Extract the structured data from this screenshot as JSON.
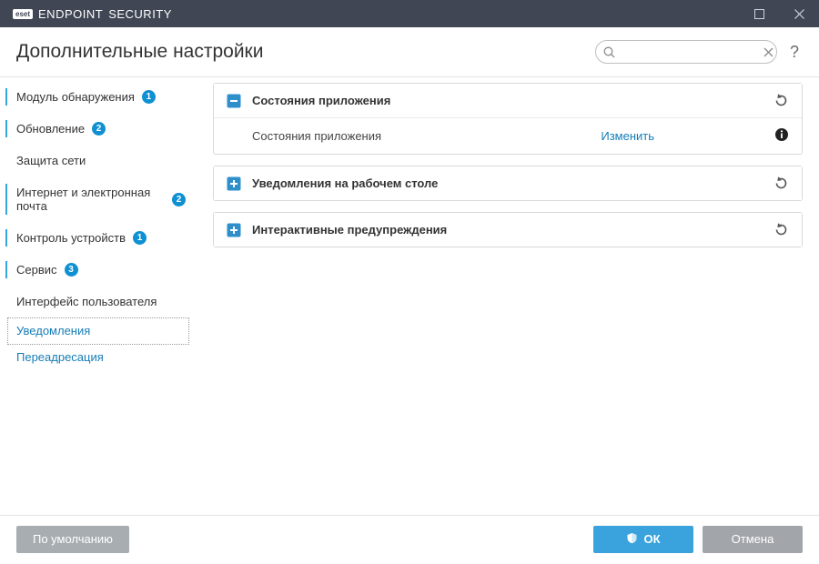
{
  "titlebar": {
    "brand_badge": "eset",
    "brand_word1": "ENDPOINT",
    "brand_word2": "SECURITY"
  },
  "header": {
    "title": "Дополнительные настройки",
    "search_placeholder": "",
    "help": "?"
  },
  "sidebar": {
    "items": [
      {
        "label": "Модуль обнаружения",
        "badge": "1",
        "active": true
      },
      {
        "label": "Обновление",
        "badge": "2",
        "active": true
      },
      {
        "label": "Защита сети",
        "badge": "",
        "active": false
      },
      {
        "label": "Интернет и электронная почта",
        "badge": "2",
        "active": true
      },
      {
        "label": "Контроль устройств",
        "badge": "1",
        "active": true
      },
      {
        "label": "Сервис",
        "badge": "3",
        "active": true
      },
      {
        "label": "Интерфейс пользователя",
        "badge": "",
        "active": false
      }
    ],
    "sub_items": [
      {
        "label": "Уведомления",
        "selected": true
      },
      {
        "label": "Переадресация",
        "selected": false
      }
    ]
  },
  "panels": {
    "p0": {
      "title": "Состояния приложения",
      "expanded": true,
      "rows": [
        {
          "label": "Состояния приложения",
          "action": "Изменить"
        }
      ]
    },
    "p1": {
      "title": "Уведомления на рабочем столе",
      "expanded": false
    },
    "p2": {
      "title": "Интерактивные предупреждения",
      "expanded": false
    }
  },
  "footer": {
    "default_btn": "По умолчанию",
    "ok_btn": "ОК",
    "cancel_btn": "Отмена"
  }
}
